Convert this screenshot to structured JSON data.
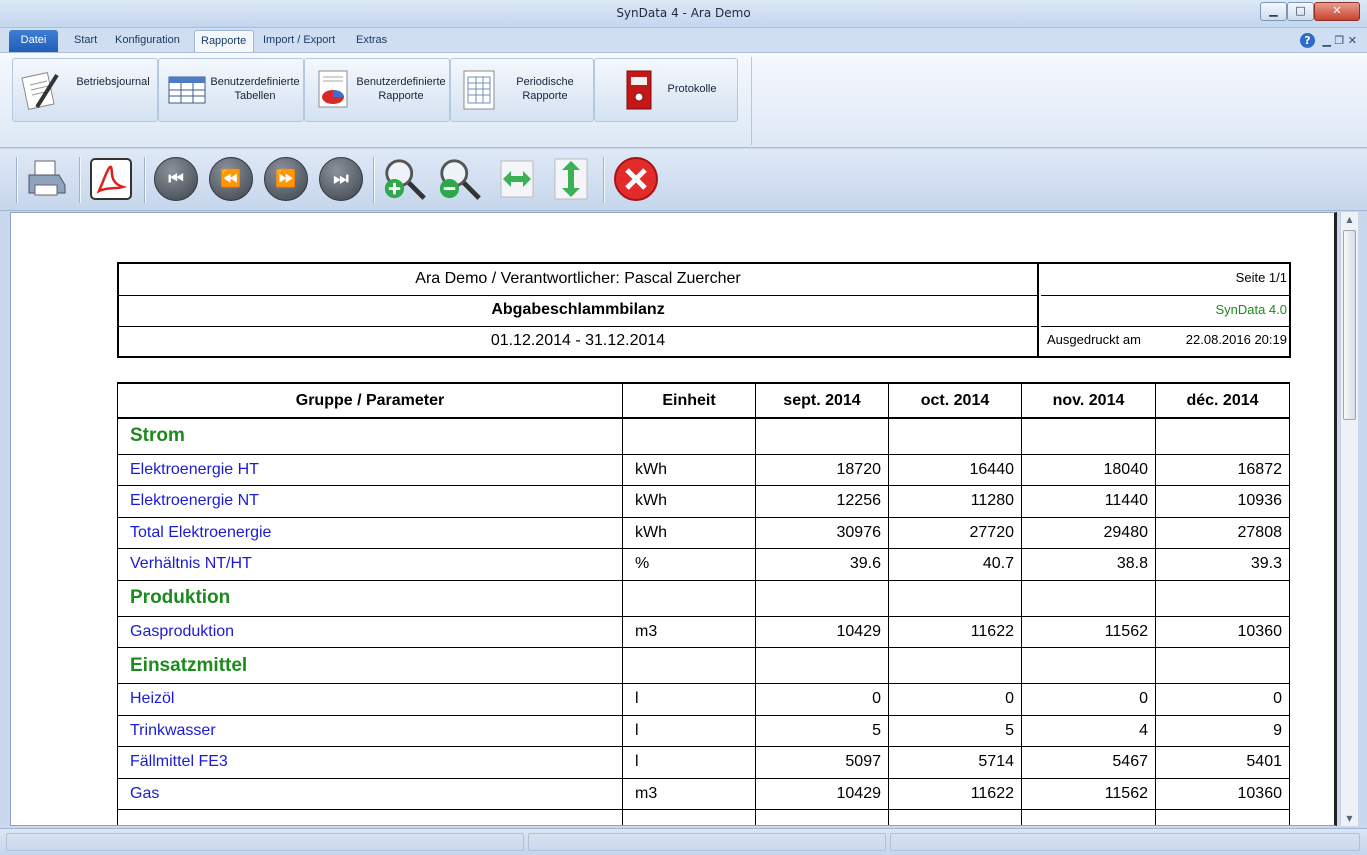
{
  "window": {
    "title": "SynData 4 - Ara Demo"
  },
  "menu": {
    "tabs": [
      {
        "label": "Datei"
      },
      {
        "label": "Start"
      },
      {
        "label": "Konfiguration"
      },
      {
        "label": "Rapporte"
      },
      {
        "label": "Import / Export"
      },
      {
        "label": "Extras"
      }
    ],
    "active_tab": "Rapporte"
  },
  "ribbon": {
    "buttons": [
      {
        "label": "Betriebsjournal",
        "icon": "journal-pen-icon"
      },
      {
        "label": "Benutzerdefinierte Tabellen",
        "icon": "table-icon"
      },
      {
        "label": "Benutzerdefinierte Rapporte",
        "icon": "pie-report-icon"
      },
      {
        "label": "Periodische Rapporte",
        "icon": "periodic-report-icon"
      },
      {
        "label": "Protokolle",
        "icon": "binder-icon"
      }
    ]
  },
  "toolbar": {
    "buttons": [
      {
        "name": "print",
        "icon": "printer-icon"
      },
      {
        "name": "pdf",
        "icon": "pdf-icon"
      },
      {
        "name": "first-page",
        "icon": "first-page-icon",
        "glyph": "⏮"
      },
      {
        "name": "previous-page",
        "icon": "previous-page-icon",
        "glyph": "⏪"
      },
      {
        "name": "next-page",
        "icon": "next-page-icon",
        "glyph": "⏩"
      },
      {
        "name": "last-page",
        "icon": "last-page-icon",
        "glyph": "⏭"
      },
      {
        "name": "zoom-in",
        "icon": "zoom-in-icon"
      },
      {
        "name": "zoom-out",
        "icon": "zoom-out-icon"
      },
      {
        "name": "fit-width",
        "icon": "fit-width-icon"
      },
      {
        "name": "fit-height",
        "icon": "fit-height-icon"
      },
      {
        "name": "close-report",
        "icon": "close-report-icon"
      }
    ]
  },
  "report": {
    "header": {
      "org_line": "Ara Demo / Verantwortlicher: Pascal Zuercher",
      "title": "Abgabeschlammbilanz",
      "period": "01.12.2014 - 31.12.2014",
      "page": "Seite 1/1",
      "software": "SynData 4.0",
      "printed_label": "Ausgedruckt am",
      "printed_value": "22.08.2016 20:19"
    },
    "columns": [
      "Gruppe / Parameter",
      "Einheit",
      "sept. 2014",
      "oct. 2014",
      "nov. 2014",
      "déc. 2014"
    ],
    "rows": [
      {
        "type": "group",
        "name": "Strom"
      },
      {
        "type": "param",
        "name": "Elektroenergie HT",
        "unit": "kWh",
        "values": [
          "18720",
          "16440",
          "18040",
          "16872"
        ]
      },
      {
        "type": "param",
        "name": "Elektroenergie NT",
        "unit": "kWh",
        "values": [
          "12256",
          "11280",
          "11440",
          "10936"
        ]
      },
      {
        "type": "param",
        "name": "Total Elektroenergie",
        "unit": "kWh",
        "values": [
          "30976",
          "27720",
          "29480",
          "27808"
        ]
      },
      {
        "type": "param",
        "name": "Verhältnis NT/HT",
        "unit": "%",
        "values": [
          "39.6",
          "40.7",
          "38.8",
          "39.3"
        ]
      },
      {
        "type": "group",
        "name": "Produktion"
      },
      {
        "type": "param",
        "name": "Gasproduktion",
        "unit": "m3",
        "values": [
          "10429",
          "11622",
          "11562",
          "10360"
        ]
      },
      {
        "type": "group",
        "name": "Einsatzmittel"
      },
      {
        "type": "param",
        "name": "Heizöl",
        "unit": "l",
        "values": [
          "0",
          "0",
          "0",
          "0"
        ]
      },
      {
        "type": "param",
        "name": "Trinkwasser",
        "unit": "l",
        "values": [
          "5",
          "5",
          "4",
          "9"
        ]
      },
      {
        "type": "param",
        "name": "Fällmittel FE3",
        "unit": "l",
        "values": [
          "5097",
          "5714",
          "5467",
          "5401"
        ]
      },
      {
        "type": "param",
        "name": "Gas",
        "unit": "m3",
        "values": [
          "10429",
          "11622",
          "11562",
          "10360"
        ]
      },
      {
        "type": "group",
        "name": ""
      }
    ]
  },
  "colors": {
    "group_text": "#1d8a1d",
    "param_text": "#1b1bd6",
    "software_text": "#1d8a1d",
    "active_tab_bg": "#1f5fb8"
  }
}
